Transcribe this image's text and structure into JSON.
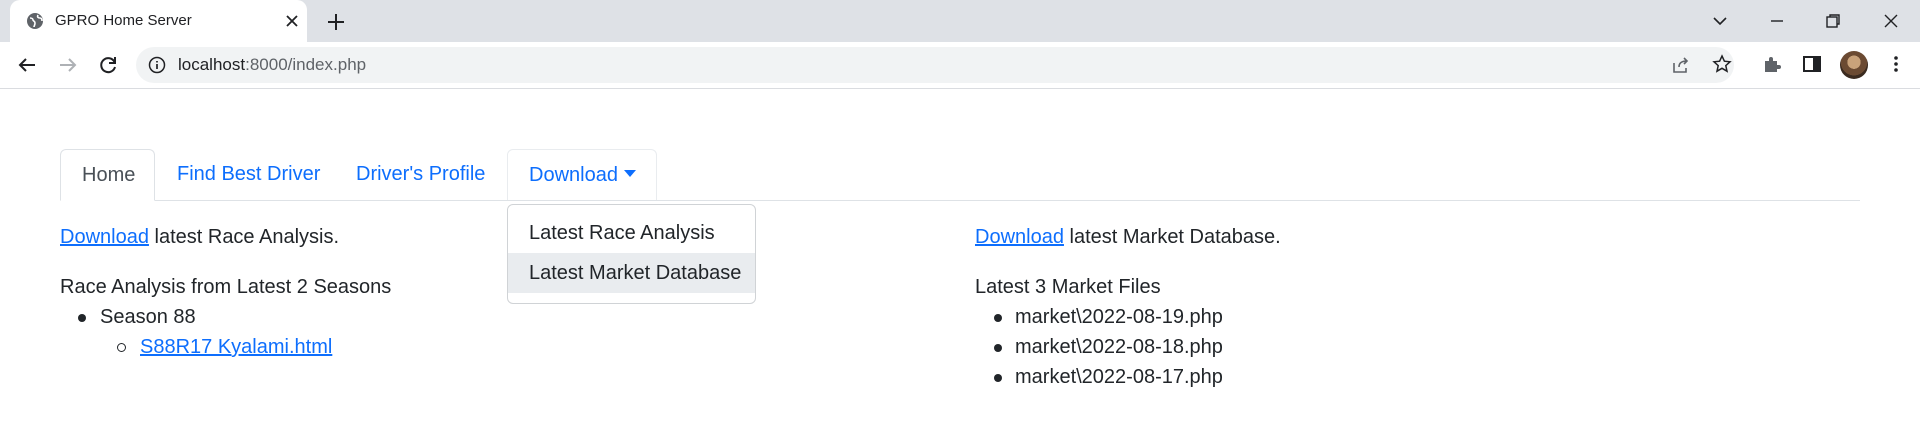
{
  "browser": {
    "tab_title": "GPRO Home Server",
    "url_host": "localhost",
    "url_path": ":8000/index.php"
  },
  "nav": {
    "tabs": [
      {
        "label": "Home"
      },
      {
        "label": "Find Best Driver"
      },
      {
        "label": "Driver's Profile"
      },
      {
        "label": "Download"
      }
    ],
    "dropdown_items": [
      {
        "label": "Latest Race Analysis"
      },
      {
        "label": "Latest Market Database"
      }
    ]
  },
  "left": {
    "download_link": "Download",
    "download_text": " latest Race Analysis.",
    "section_title": "Race Analysis from Latest 2 Seasons",
    "season": "Season 88",
    "race_file": "S88R17 Kyalami.html"
  },
  "right": {
    "download_link": "Download",
    "download_text": " latest Market Database.",
    "section_title": "Latest 3 Market Files",
    "files": [
      "market\\2022-08-19.php",
      "market\\2022-08-18.php",
      "market\\2022-08-17.php"
    ]
  },
  "colors": {
    "link": "#0d6efd",
    "hover_bg": "#e9ecef",
    "tabstrip": "#dee1e6"
  },
  "icons": [
    "globe-icon",
    "close-icon",
    "plus-icon",
    "chevron-down-icon",
    "minimize-icon",
    "restore-icon",
    "window-close-icon",
    "back-icon",
    "forward-icon",
    "reload-icon",
    "info-icon",
    "share-icon",
    "star-icon",
    "puzzle-icon",
    "side-panel-icon",
    "profile-avatar"
  ]
}
